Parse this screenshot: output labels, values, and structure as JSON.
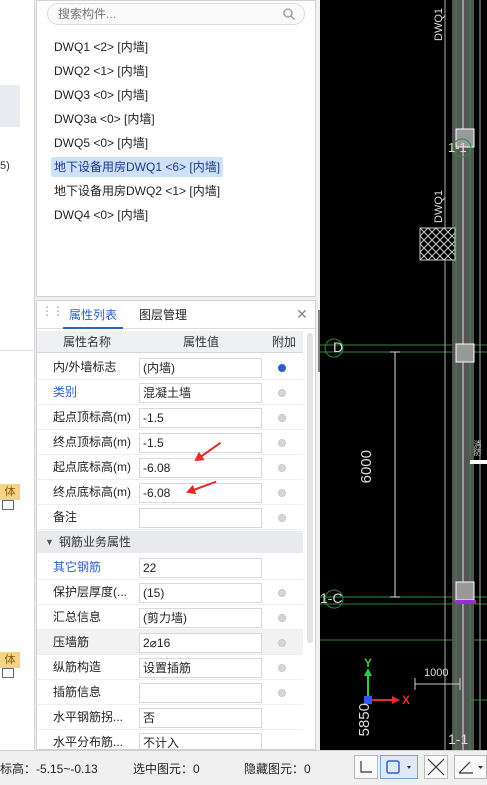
{
  "left_strip": {
    "partial_text": "5)",
    "tag_label": "体验"
  },
  "component_list": {
    "search_placeholder": "搜索构件...",
    "items": [
      {
        "label": "DWQ1 <2> [内墙]",
        "selected": false
      },
      {
        "label": "DWQ2 <1> [内墙]",
        "selected": false
      },
      {
        "label": "DWQ3 <0> [内墙]",
        "selected": false
      },
      {
        "label": "DWQ3a <0> [内墙]",
        "selected": false
      },
      {
        "label": "DWQ5 <0> [内墙]",
        "selected": false
      },
      {
        "label": "地下设备用房DWQ1 <6> [内墙]",
        "selected": true
      },
      {
        "label": "地下设备用房DWQ2 <1> [内墙]",
        "selected": false
      },
      {
        "label": "DWQ4 <0> [内墙]",
        "selected": false
      }
    ]
  },
  "properties": {
    "tabs": [
      "属性列表",
      "图层管理"
    ],
    "columns": [
      "属性名称",
      "属性值",
      "附加"
    ],
    "rows": [
      {
        "name": "内/外墙标志",
        "value": "(内墙)",
        "radio": "on",
        "blue": false
      },
      {
        "name": "类别",
        "value": "混凝土墙",
        "radio": "off",
        "blue": true
      },
      {
        "name": "起点顶标高(m)",
        "value": "-1.5",
        "radio": "off",
        "blue": false
      },
      {
        "name": "终点顶标高(m)",
        "value": "-1.5",
        "radio": "off",
        "blue": false
      },
      {
        "name": "起点底标高(m)",
        "value": "-6.08",
        "radio": "off",
        "blue": false
      },
      {
        "name": "终点底标高(m)",
        "value": "-6.08",
        "radio": "off",
        "blue": false
      },
      {
        "name": "备注",
        "value": "",
        "radio": "off",
        "blue": false
      }
    ],
    "group_label": "钢筋业务属性",
    "rebar_rows": [
      {
        "name": "其它钢筋",
        "value": "22",
        "radio": "none",
        "blue": true
      },
      {
        "name": "保护层厚度(...",
        "value": "(15)",
        "radio": "off",
        "blue": false
      },
      {
        "name": "汇总信息",
        "value": "(剪力墙)",
        "radio": "off",
        "blue": false
      },
      {
        "name": "压墙筋",
        "value": "2⌀16",
        "radio": "off",
        "blue": false
      },
      {
        "name": "纵筋构造",
        "value": "设置插筋",
        "radio": "off",
        "blue": false
      },
      {
        "name": "插筋信息",
        "value": "",
        "radio": "off",
        "blue": false
      },
      {
        "name": "水平钢筋拐...",
        "value": "否",
        "radio": "none",
        "blue": false
      },
      {
        "name": "水平分布筋...",
        "value": "不计入",
        "radio": "none",
        "blue": false
      }
    ]
  },
  "cad": {
    "labels": {
      "dwq_top": "DWQ1",
      "dwq_mid": "DWQ1",
      "axis_1_1_top": "1-1",
      "axis_d": "D",
      "axis_c": "1-C",
      "dim_6000": "6000",
      "dim_1000": "1000",
      "dim_5850": "5850",
      "axis_1_1_bottom": "1-1",
      "ucs_y": "Y",
      "ucs_x": "X",
      "side_text": "消防"
    }
  },
  "status_bar": {
    "elevation": "标高：-5.15~-0.13",
    "selected": "选中图元：0",
    "hidden": "隐藏图元：0"
  }
}
